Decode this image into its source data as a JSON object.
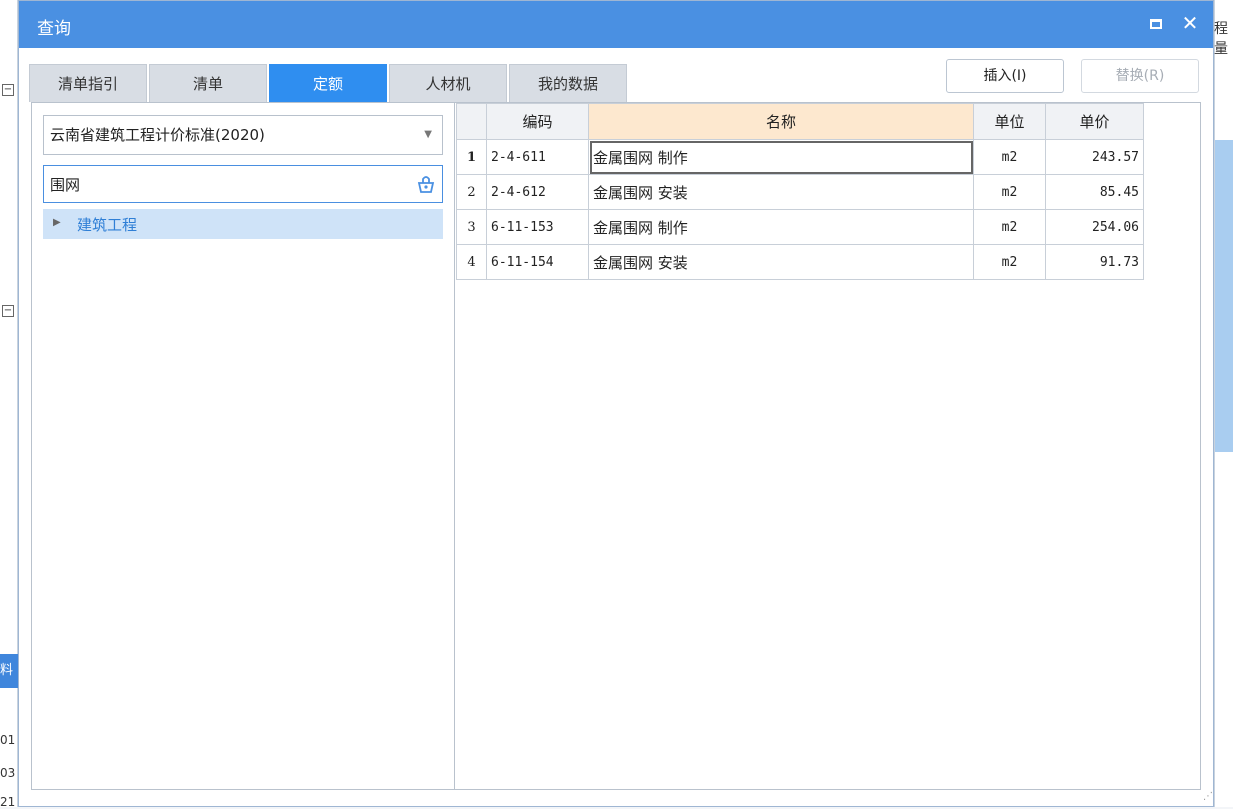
{
  "background": {
    "right_text": "程量",
    "left_labels": [
      "料",
      "01",
      "03",
      "21"
    ]
  },
  "dialog": {
    "title": "查询",
    "close_glyph": "✕"
  },
  "tabs": [
    {
      "label": "清单指引",
      "active": false
    },
    {
      "label": "清单",
      "active": false
    },
    {
      "label": "定额",
      "active": true
    },
    {
      "label": "人材机",
      "active": false
    },
    {
      "label": "我的数据",
      "active": false
    }
  ],
  "toolbar": {
    "insert_label": "插入(I)",
    "replace_label": "替换(R)"
  },
  "left": {
    "standard": "云南省建筑工程计价标准(2020)",
    "search_value": "围网",
    "tree_item": "建筑工程"
  },
  "table": {
    "headers": {
      "code": "编码",
      "name": "名称",
      "unit": "单位",
      "price": "单价"
    },
    "rows": [
      {
        "idx": "1",
        "code": "2-4-611",
        "name": "金属围网 制作",
        "unit": "m2",
        "price": "243.57"
      },
      {
        "idx": "2",
        "code": "2-4-612",
        "name": "金属围网 安装",
        "unit": "m2",
        "price": "85.45"
      },
      {
        "idx": "3",
        "code": "6-11-153",
        "name": "金属围网 制作",
        "unit": "m2",
        "price": "254.06"
      },
      {
        "idx": "4",
        "code": "6-11-154",
        "name": "金属围网 安装",
        "unit": "m2",
        "price": "91.73"
      }
    ]
  },
  "colors": {
    "titlebar": "#4a90e2",
    "active_tab": "#2f8ef0",
    "name_header": "#fde8cf",
    "tree_selected": "#cfe3f8"
  }
}
